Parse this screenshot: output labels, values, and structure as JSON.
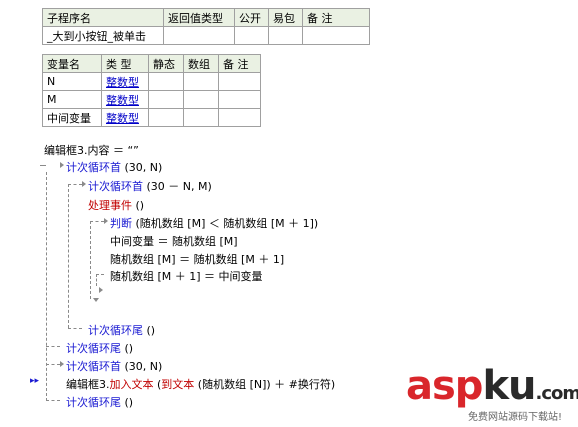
{
  "subroutine_table": {
    "headers": [
      "子程序名",
      "返回值类型",
      "公开",
      "易包",
      "备 注"
    ],
    "row": [
      "_大到小按钮_被单击",
      "",
      "",
      "",
      ""
    ]
  },
  "variable_table": {
    "headers": [
      "变量名",
      "类 型",
      "静态",
      "数组",
      "备 注"
    ],
    "rows": [
      [
        "N",
        "整数型",
        "",
        "",
        ""
      ],
      [
        "M",
        "整数型",
        "",
        "",
        ""
      ],
      [
        "中间变量",
        "整数型",
        "",
        "",
        ""
      ]
    ]
  },
  "code": {
    "l1": "编辑框3.内容 ＝ “”",
    "l2_kw": "计次循环首",
    "l2_args": " (30, N)",
    "l3_kw": "计次循环首",
    "l3_args": " (30 － N, M)",
    "l4_kw": "处理事件",
    "l4_args": " ()",
    "l5_kw": "判断",
    "l5_args": " (随机数组 [M] ＜ 随机数组 [M ＋ 1])",
    "l6": "中间变量 ＝ 随机数组 [M]",
    "l7": "随机数组 [M] ＝ 随机数组 [M ＋ 1]",
    "l8": "随机数组 [M ＋ 1] ＝ 中间变量",
    "l9_kw": "计次循环尾",
    "l9_args": " ()",
    "l10_kw": "计次循环尾",
    "l10_args": " ()",
    "l11_kw": "计次循环首",
    "l11_args": " (30, N)",
    "l12_obj": "编辑框3.",
    "l12_method": "加入文本",
    "l12_paren": " (",
    "l12_func": "到文本",
    "l12_rest": " (随机数组 [N]) ＋ #换行符)",
    "l13_kw": "计次循环尾",
    "l13_args": " ()"
  },
  "marker": "▸▸",
  "logo": {
    "main_a": "asp",
    "main_b": "ku",
    "dot_com": ".com",
    "subtitle": "免费网站源码下载站!"
  },
  "colors": {
    "keyword": "#1a1ad2",
    "event": "#c00000",
    "header_bg": "#eaf1e3",
    "logo_red": "#d9262b"
  }
}
